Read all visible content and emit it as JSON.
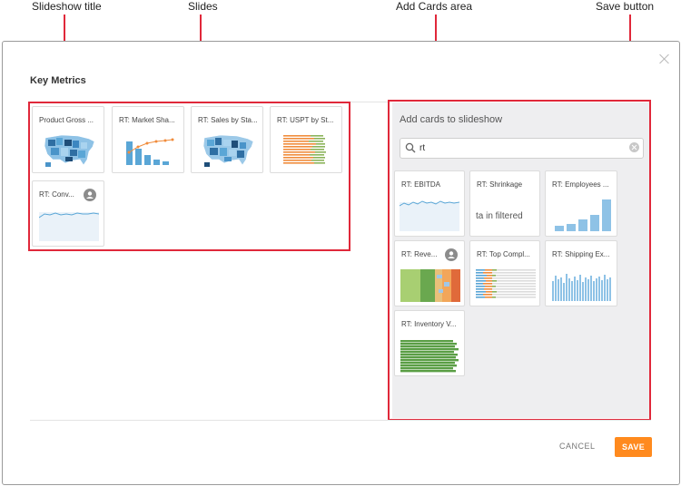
{
  "annotations": {
    "slideshow_title": "Slideshow title",
    "slides": "Slides",
    "add_cards_area": "Add Cards area",
    "save_button": "Save button"
  },
  "modal": {
    "title": "Key Metrics",
    "close_icon": "close-icon"
  },
  "slides": [
    {
      "title": "Product Gross ...",
      "preview": "us-map"
    },
    {
      "title": "RT: Market Sha...",
      "preview": "pareto-bar-line"
    },
    {
      "title": "RT: Sales by Sta...",
      "preview": "us-map"
    },
    {
      "title": "RT: USPT by St...",
      "preview": "stacked-horizontal-bars"
    },
    {
      "title": "RT: Conv...",
      "preview": "line",
      "badge": "user-shield-icon"
    }
  ],
  "add_cards": {
    "title": "Add cards to slideshow",
    "search_value": "rt",
    "search_placeholder": "",
    "cards": [
      {
        "title": "RT: EBITDA",
        "preview": "line"
      },
      {
        "title": "RT: Shrinkage",
        "preview": "text",
        "preview_text": "ta in filtered"
      },
      {
        "title": "RT: Employees ...",
        "preview": "vertical-bars"
      },
      {
        "title": "RT: Reve...",
        "preview": "stacked-area-columns",
        "badge": "user-shield-icon"
      },
      {
        "title": "RT: Top Compl...",
        "preview": "stacked-horizontal-bars"
      },
      {
        "title": "RT: Shipping Ex...",
        "preview": "vertical-bars-dense"
      },
      {
        "title": "RT: Inventory V...",
        "preview": "green-horizontal-bars"
      }
    ]
  },
  "footer": {
    "cancel_label": "CANCEL",
    "save_label": "SAVE"
  },
  "colors": {
    "highlight": "#e0283a",
    "save_button": "#ff8a1e",
    "chart_blue": "#5aa6d6",
    "chart_orange": "#f08c3c",
    "chart_green": "#5a9e45"
  }
}
